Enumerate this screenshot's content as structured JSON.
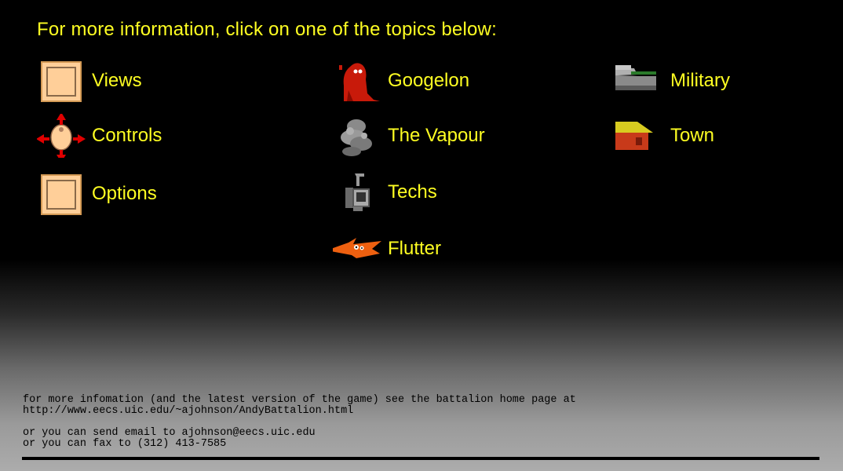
{
  "header": {
    "title": "For more information, click on one of the topics below:"
  },
  "topics": {
    "views": {
      "label": "Views",
      "icon": "views-icon"
    },
    "controls": {
      "label": "Controls",
      "icon": "controls-icon"
    },
    "options": {
      "label": "Options",
      "icon": "options-icon"
    },
    "googelon": {
      "label": "Googelon",
      "icon": "googelon-monster-icon"
    },
    "vapour": {
      "label": "The Vapour",
      "icon": "vapour-cloud-icon"
    },
    "techs": {
      "label": "Techs",
      "icon": "techs-robot-icon"
    },
    "flutter": {
      "label": "Flutter",
      "icon": "flutter-creature-icon"
    },
    "military": {
      "label": "Military",
      "icon": "tank-icon"
    },
    "town": {
      "label": "Town",
      "icon": "house-icon"
    }
  },
  "footer": {
    "line1": "for more infomation (and the latest version of the game) see the battalion home page at",
    "line2": "http://www.eecs.uic.edu/~ajohnson/AndyBattalion.html",
    "line3": "or you can send email to ajohnson@eecs.uic.edu",
    "line4": "or you can fax to (312) 413-7585"
  },
  "colors": {
    "text": "#ffff22",
    "background": "#000000",
    "panel": "#ffcf99"
  }
}
